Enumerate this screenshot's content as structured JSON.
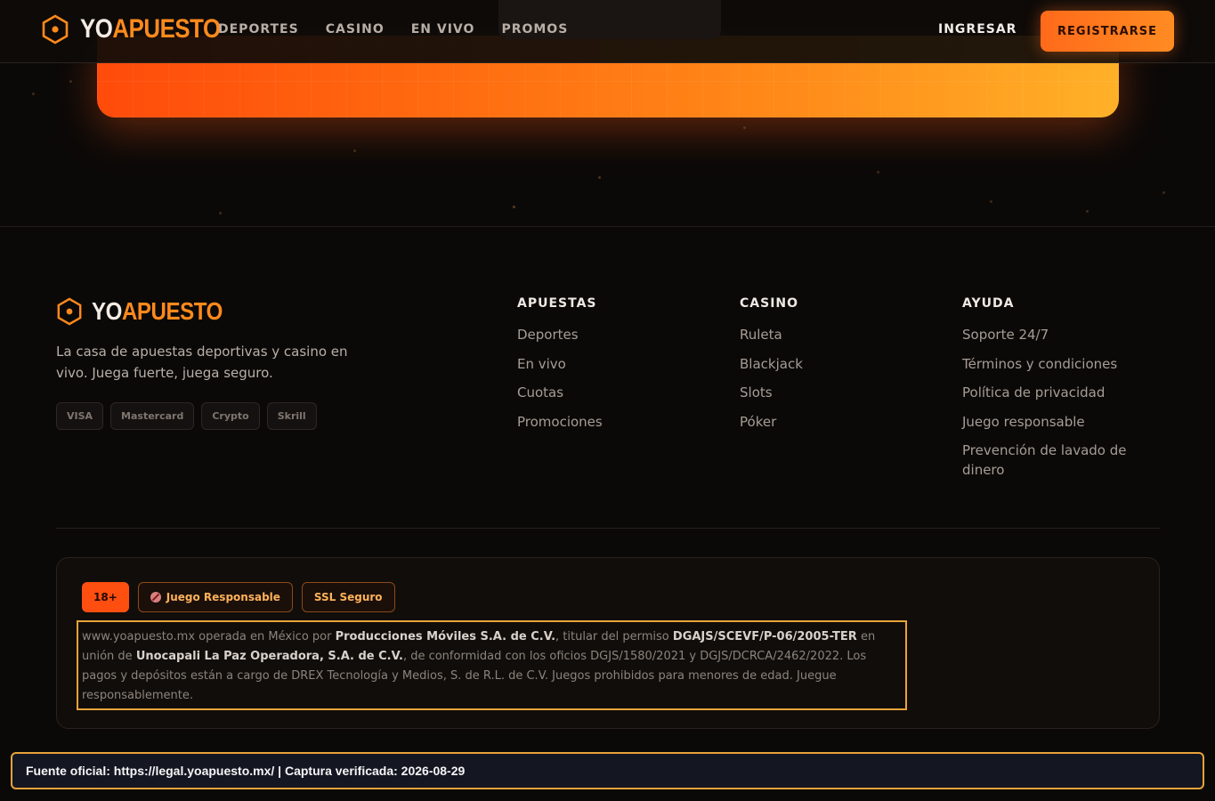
{
  "brand": {
    "part1": "YO",
    "part2": "APUESTO",
    "accent": "#ff8a1c"
  },
  "header": {
    "nav": [
      "DEPORTES",
      "CASINO",
      "EN VIVO",
      "PROMOS"
    ],
    "login_label": "INGRESAR",
    "register_label": "REGISTRARSE"
  },
  "footer": {
    "tagline": "La casa de apuestas deportivas y casino en vivo. Juega fuerte, juega seguro.",
    "payments": [
      "VISA",
      "Mastercard",
      "Crypto",
      "Skrill"
    ],
    "columns": [
      {
        "title": "APUESTAS",
        "links": [
          "Deportes",
          "En vivo",
          "Cuotas",
          "Promociones"
        ]
      },
      {
        "title": "CASINO",
        "links": [
          "Ruleta",
          "Blackjack",
          "Slots",
          "Póker"
        ]
      },
      {
        "title": "AYUDA",
        "links": [
          "Soporte 24/7",
          "Términos y condiciones",
          "Política de privacidad",
          "Juego responsable",
          "Prevención de lavado de dinero"
        ]
      }
    ]
  },
  "legal": {
    "badges": {
      "age": "18+",
      "responsible": "Juego Responsable",
      "ssl": "SSL Seguro"
    },
    "responsible_icon": "no-minors-icon",
    "text_1": "www.yoapuesto.mx operada en México por ",
    "operator": "Producciones Móviles S.A. de C.V.",
    "text_2": ", titular del permiso ",
    "permit": "DGAJS/SCEVF/P-06/2005-TER",
    "text_3": " en unión de ",
    "partner": "Unocapali La Paz Operadora, S.A. de C.V.",
    "text_4": ", de conformidad con los oficios DGJS/1580/2021 y DGJS/DCRCA/2462/2022. Los pagos y depósitos están a cargo de DREX Tecnología y Medios, S. de R.L. de C.V. Juegos prohibidos para menores de edad. Juegue responsablemente."
  },
  "source_bar": "Fuente oficial: https://legal.yoapuesto.mx/ | Captura verificada: 2026-08-29"
}
